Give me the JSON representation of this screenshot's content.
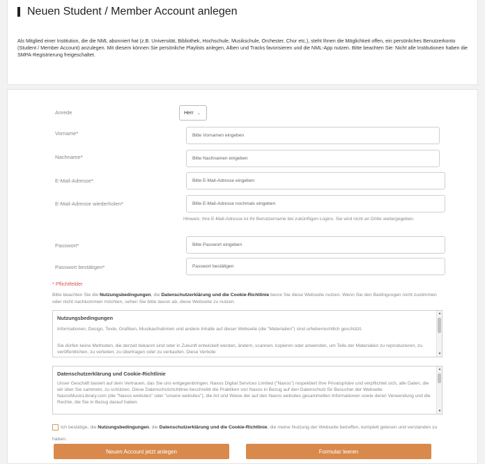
{
  "header": {
    "title": "Neuen Student / Member Account anlegen",
    "intro": "Als Mitglied einer Institution, die die NML abonniert hat (z.B. Universität, Bibliothek, Hochschule, Musikschule, Orchester, Chor etc.), steht Ihnen die Möglichkeit offen, ein persönliches Benutzerkonto (Student / Member Account) anzulegen. Mit diesem können Sie persönliche Playlists anlegen, Alben und Tracks favorisieren und die NML-App nutzen. Bitte beachten Sie: Nicht alle Institutionen haben die SMPA-Registrierung freigeschaltet."
  },
  "form": {
    "anrede": {
      "label": "Anrede",
      "value": "Herr"
    },
    "vorname": {
      "label": "Vorname",
      "placeholder": "Bitte Vornamen eingeben"
    },
    "nachname": {
      "label": "Nachname",
      "placeholder": "Bitte Nachnamen eingeben"
    },
    "email": {
      "label": "E-Mail-Adresse",
      "placeholder": "Bitte E-Mail-Adresse eingeben"
    },
    "email_repeat": {
      "label": "E-Mail-Adresse wiederholen",
      "placeholder": "Bitte E-Mail-Adresse nochmals eingeben"
    },
    "email_hint": "Hinweis: Ihre E-Mail-Adresse ist Ihr Benutzername bei zukünftigen Logins. Sie wird nicht an Dritte weitergegeben.",
    "password": {
      "label": "Passwort",
      "placeholder": "Bitte Passwort eingeben"
    },
    "password_confirm": {
      "label": "Passwort bestätigen",
      "placeholder": "Passwort bestätigen"
    },
    "required_marker": "*",
    "required_note": "* Pflichtfelder"
  },
  "notice": {
    "prefix": "Bitte beachten Sie die ",
    "terms_link": "Nutzungsbedingungen",
    "sep1": ", die ",
    "privacy_link": "Datenschutzerklärung und die Cookie-Richtlinie",
    "suffix": " bevor Sie diese Webseite nutzen. Wenn Sie den Bedingungen nicht zustimmen oder nicht nachkommen möchten, sehen Sie bitte davon ab, diese Webseite zu nutzen."
  },
  "terms_box": {
    "title": "Nutzungsbedingungen",
    "p1": "Informationen, Design, Texte, Grafiken, Musikaufnahmen und andere Inhalte auf dieser Webseite (die \"Materialien\") sind urheberrechtlich geschützt.",
    "p2": "Sie dürfen keine Methoden, die derzeit bekannt sind oder in Zukunft entwickelt werden, ändern, scannen, kopieren oder anwenden, um Teile der Materialien zu reproduzieren, zu veröffentlichen, zu verteilen, zu übertragen oder zu verkaufen. Diese Verbote"
  },
  "privacy_box": {
    "title": "Datenschutzerklärung und Cookie-Richtlinie",
    "text": "Unser Geschäft basiert auf dem Vertrauen, das Sie uns entgegenbringen. Naxos Digital Services Limited (\"Naxos\") respektiert Ihre Privatsphäre und verpflichtet sich, alle Daten, die wir über Sie sammeln, zu schützen. Diese Datenschutzrichtlinie beschreibt die Praktiken von Naxos in Bezug auf den Datenschutz für Besucher der Webseite NaxosMusicLibrary.com (die \"Naxos websites\" oder \"unsere websites\"), die Art und Weise der auf den Naxos websites gesammelten Informationen sowie deren Verwendung und die Rechte, die Sie in Bezug darauf haben."
  },
  "consent": {
    "prefix": "Ich bestätige, die ",
    "terms": "Nutzungsbedingungen",
    "sep": ", die ",
    "privacy": "Datenschutzerklärung und die Cookie-Richtlinie",
    "suffix": ", die meine Nutzung der Webseite betreffen, komplett gelesen und verstanden zu haben."
  },
  "buttons": {
    "submit": "Neuen Account jetzt anlegen",
    "reset": "Formular leeren"
  },
  "colors": {
    "accent": "#d9894b",
    "required": "#d9534f"
  }
}
